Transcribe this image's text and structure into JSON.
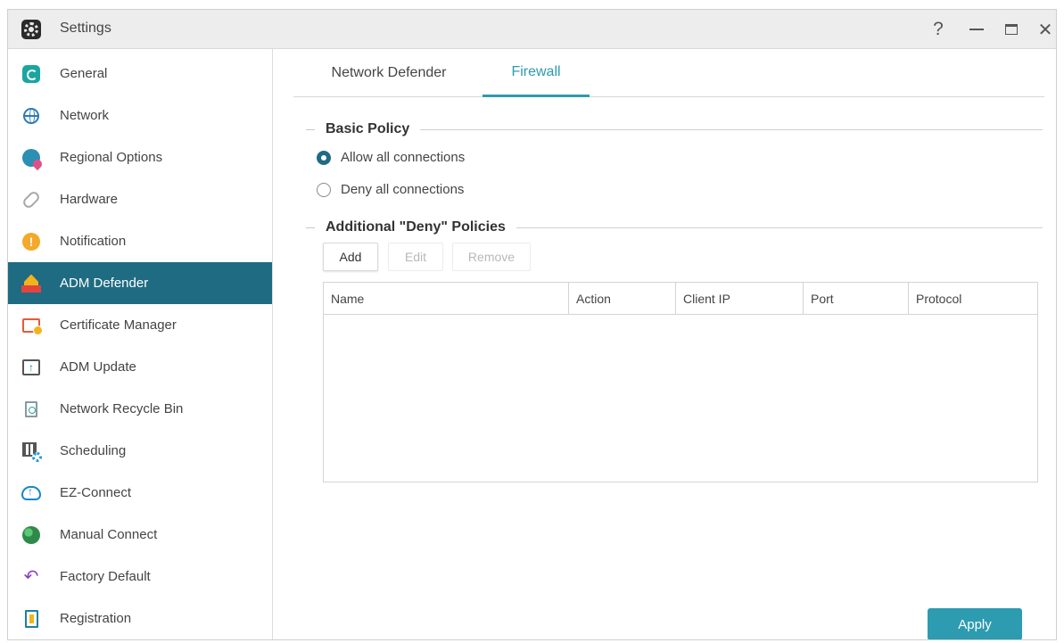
{
  "window": {
    "title": "Settings",
    "controls": {
      "help": "?",
      "close": "✕"
    }
  },
  "sidebar": {
    "active_index": 5,
    "items": [
      {
        "label": "General",
        "icon": "general-icon"
      },
      {
        "label": "Network",
        "icon": "globe-icon"
      },
      {
        "label": "Regional Options",
        "icon": "regional-globe-pin-icon"
      },
      {
        "label": "Hardware",
        "icon": "hardware-link-icon"
      },
      {
        "label": "Notification",
        "icon": "exclamation-circle-icon"
      },
      {
        "label": "ADM Defender",
        "icon": "shield-firewall-icon"
      },
      {
        "label": "Certificate Manager",
        "icon": "certificate-icon"
      },
      {
        "label": "ADM Update",
        "icon": "upload-monitor-icon"
      },
      {
        "label": "Network Recycle Bin",
        "icon": "recycle-bin-icon"
      },
      {
        "label": "Scheduling",
        "icon": "schedule-gear-icon"
      },
      {
        "label": "EZ-Connect",
        "icon": "cloud-upload-icon"
      },
      {
        "label": "Manual Connect",
        "icon": "planet-icon"
      },
      {
        "label": "Factory Default",
        "icon": "undo-arrow-icon"
      },
      {
        "label": "Registration",
        "icon": "clipboard-icon"
      }
    ]
  },
  "tabs": [
    {
      "label": "Network Defender",
      "active": false
    },
    {
      "label": "Firewall",
      "active": true
    }
  ],
  "basic_policy": {
    "title": "Basic Policy",
    "options": [
      {
        "label": "Allow all connections",
        "checked": true
      },
      {
        "label": "Deny all connections",
        "checked": false
      }
    ]
  },
  "additional_policies": {
    "title": "Additional \"Deny\" Policies",
    "buttons": {
      "add": "Add",
      "edit": "Edit",
      "remove": "Remove"
    },
    "columns": [
      "Name",
      "Action",
      "Client IP",
      "Port",
      "Protocol"
    ],
    "rows": []
  },
  "footer": {
    "apply": "Apply"
  },
  "colors": {
    "accent": "#2d9bb0",
    "active_sidebar": "#1f6b82",
    "titlebar": "#ededed"
  }
}
